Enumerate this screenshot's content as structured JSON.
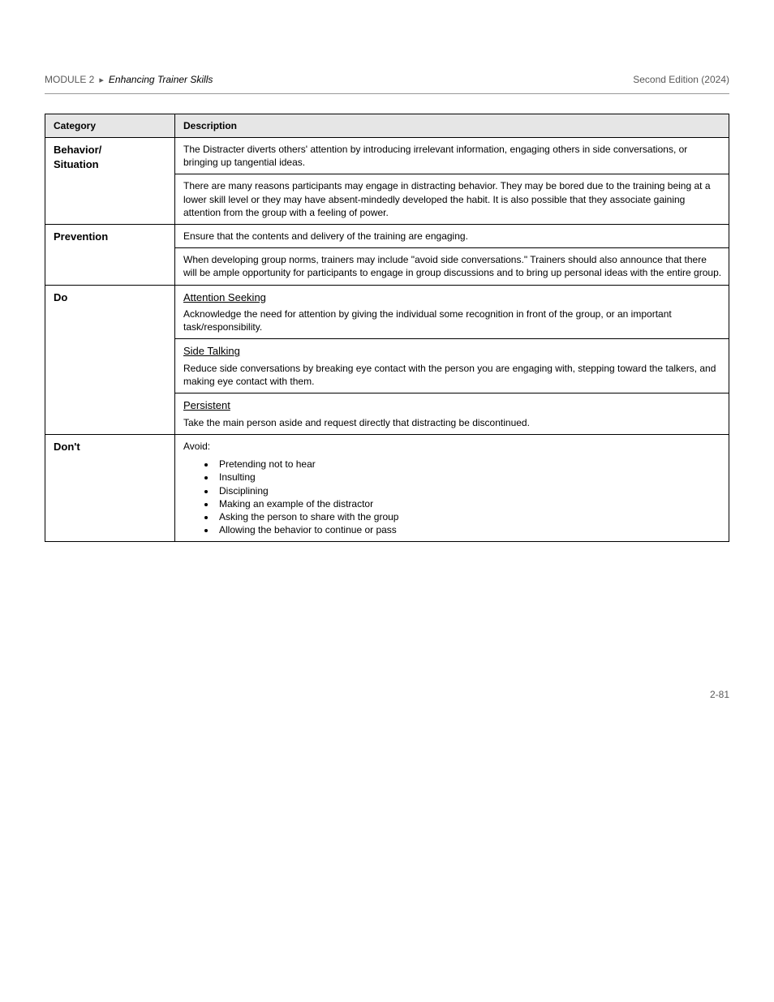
{
  "header": {
    "breadcrumb_root": "MODULE 2",
    "breadcrumb_icon": "▸",
    "breadcrumb_title": "Enhancing Trainer Skills",
    "edition_line": "Second Edition (2024)"
  },
  "table": {
    "head1": "Category",
    "head2": "Description",
    "rows": [
      {
        "left": "Behavior/\nSituation",
        "top": "The Distracter diverts others' attention by introducing irrelevant information, engaging others in side conversations, or bringing up tangential ideas.",
        "bottom": "There are many reasons participants may engage in distracting behavior. They may be bored due to the training being at a lower skill level or they may have absent-mindedly developed the habit. It is also possible that they associate gaining attention from the group with a feeling of power."
      },
      {
        "left": "Prevention",
        "top": "Ensure that the contents and delivery of the training are engaging.",
        "bottom": "When developing group norms, trainers may include \"avoid side conversations.\" Trainers should also announce that there will be ample opportunity for participants to engage in group discussions and to bring up personal ideas with the entire group."
      },
      {
        "left": "Do",
        "sections": [
          {
            "heading": "Attention Seeking",
            "text": "Acknowledge the need for attention by giving the individual some recognition in front of the group, or an important task/responsibility."
          },
          {
            "heading": "Side Talking",
            "text": "Reduce side conversations by breaking eye contact with the person you are engaging with, stepping toward the talkers, and making eye contact with them."
          },
          {
            "heading": "Persistent",
            "text": "Take the main person aside and request directly that distracting be discontinued."
          }
        ]
      },
      {
        "left": "Don't",
        "top": "Avoid:",
        "bullets": [
          "Pretending not to hear",
          "Insulting",
          "Disciplining",
          "Making an example of the distractor",
          "Asking the person to share with the group",
          "Allowing the behavior to continue or pass"
        ]
      }
    ]
  },
  "footer": {
    "page": "2-81"
  }
}
